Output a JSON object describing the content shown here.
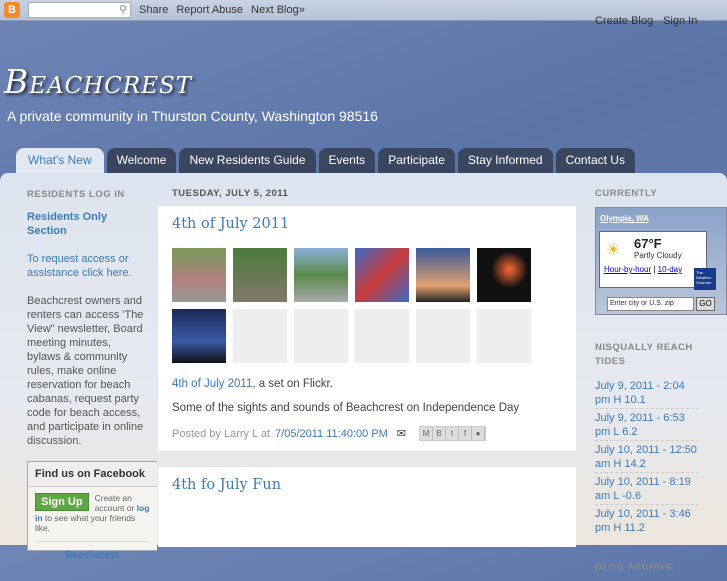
{
  "navbar": {
    "share": "Share",
    "report": "Report Abuse",
    "next": "Next Blog»",
    "create": "Create Blog",
    "signin": "Sign In",
    "search_placeholder": ""
  },
  "header": {
    "title": "Beachcrest",
    "description": "A private community in Thurston County, Washington 98516"
  },
  "tabs": [
    "What's New",
    "Welcome",
    "New Residents Guide",
    "Events",
    "Participate",
    "Stay Informed",
    "Contact Us"
  ],
  "left": {
    "heading": "RESIDENTS LOG IN",
    "residents_link": "Residents Only Section",
    "request_link": "To request access or assistance click here.",
    "body": "Beachcrest owners and renters can access 'The View\" newsletter, Board meeting minutes, bylaws & community rules, make online reservation for beach cabanas, request party code for beach access, and participate in online discussion.",
    "facebook": {
      "heading": "Find us on Facebook",
      "signup": "Sign Up",
      "text1": "Create an account or",
      "login": "log in",
      "text2": "to see what your friends like.",
      "page": "Beachcrest"
    }
  },
  "main": {
    "date": "TUESDAY, JULY 5, 2011",
    "post1": {
      "title": "4th of July 2011",
      "flickr_link": "4th of July 2011",
      "flickr_text": ", a set on Flickr.",
      "body": "Some of the sights and sounds of Beachcrest on Independence Day",
      "posted_by": "Posted by Larry L at",
      "timestamp": "7/05/2011 11:40:00 PM"
    },
    "post2": {
      "title": "4th fo July Fun"
    }
  },
  "right": {
    "heading": "CURRENTLY",
    "weather": {
      "city": "Olympia, WA",
      "temp": "67°F",
      "cond": "Partly Cloudy",
      "hourly": "Hour-by-hour",
      "tenday": "10-day",
      "input_placeholder": "Enter city or U.S. zip",
      "go": "GO",
      "brand": "The Weather Channel"
    },
    "tides_heading": "NISQUALLY REACH TIDES",
    "tides": [
      "July 9, 2011 - 2:04 pm H 10.1",
      "July 9, 2011 - 6:53 pm L 6.2",
      "July 10, 2011 - 12:50 am H 14.2",
      "July 10, 2011 - 8:19 am L -0.6",
      "July 10, 2011 - 3:46 pm H 11.2"
    ],
    "archive_heading": "BLOG ARCHIVE"
  }
}
